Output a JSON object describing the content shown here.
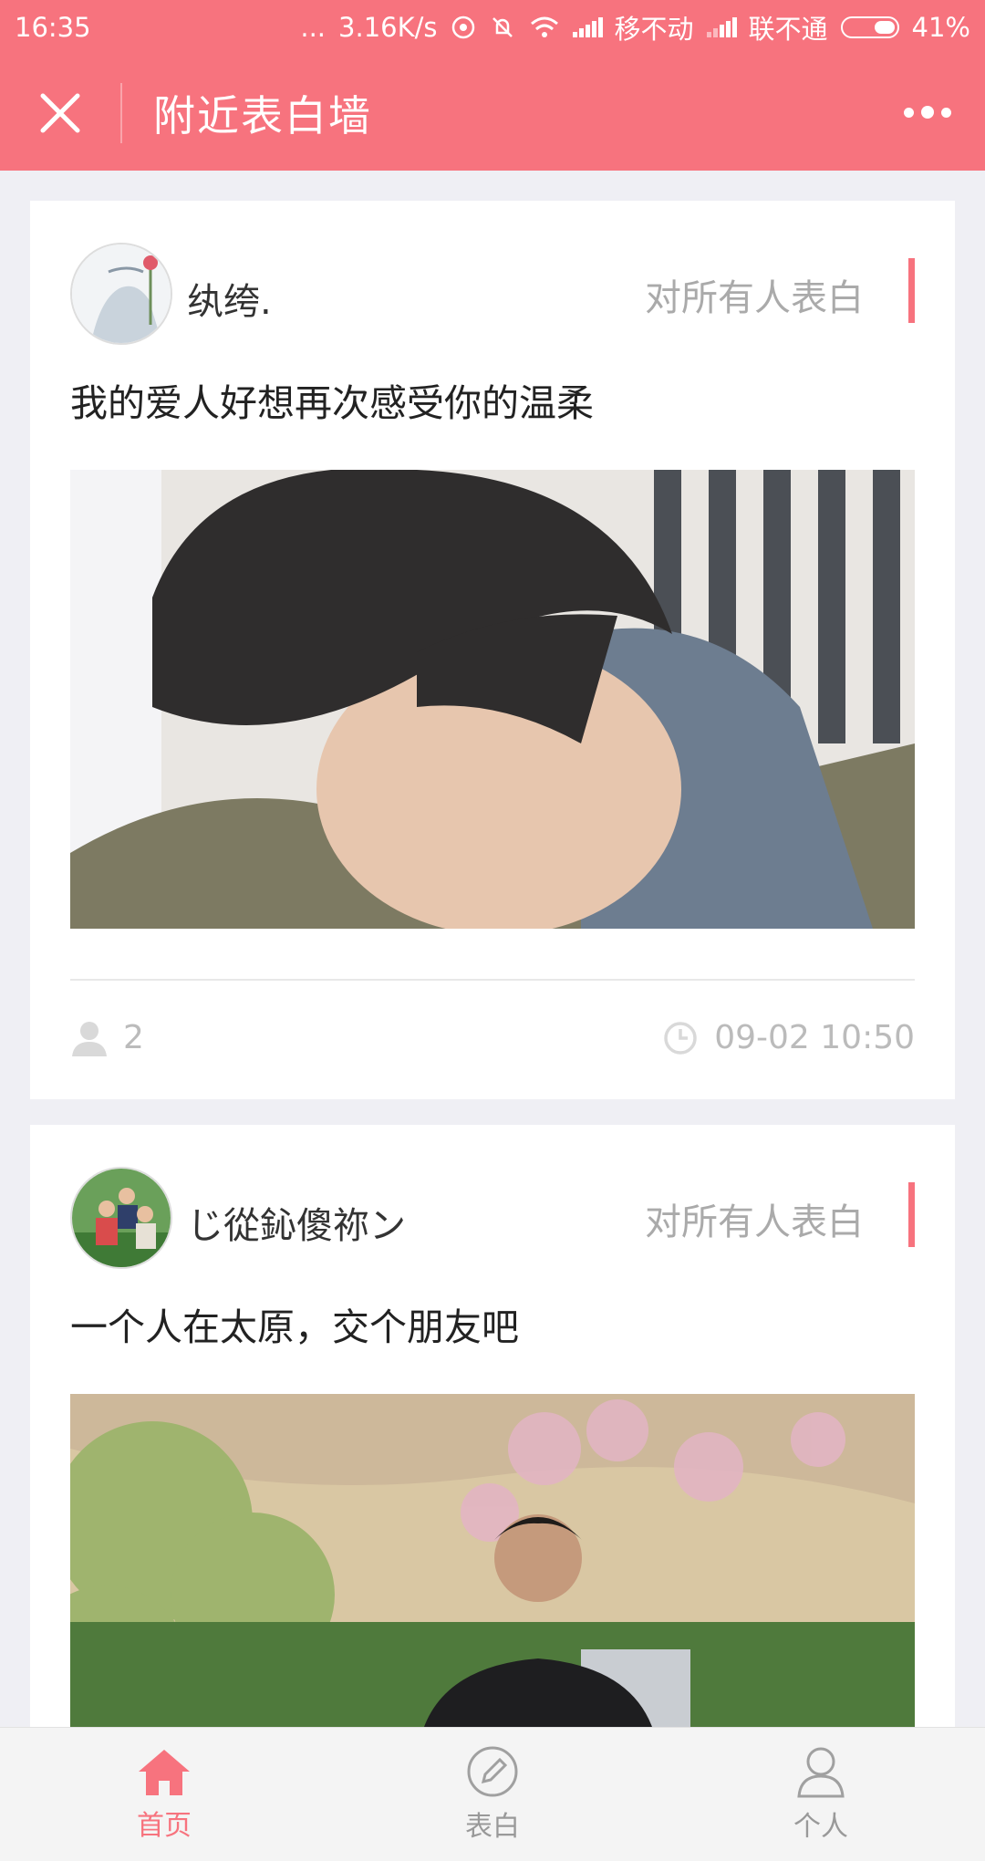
{
  "status_bar": {
    "time": "16:35",
    "dots": "...",
    "speed": "3.16K/s",
    "carrier1": "移不动",
    "carrier2": "联不通",
    "battery": "41%"
  },
  "header": {
    "title": "附近表白墙",
    "close_icon": "close-icon",
    "more_icon": "more-icon"
  },
  "posts": [
    {
      "username": "纨绔.",
      "target": "对所有人表白",
      "text": "我的爱人好想再次感受你的温柔",
      "likes": "2",
      "time": "09-02 10:50"
    },
    {
      "username": "じ從鈊傻祢ン",
      "target": "对所有人表白",
      "text": "一个人在太原，交个朋友吧"
    }
  ],
  "tabs": [
    {
      "label": "首页",
      "icon": "home-icon",
      "active": true
    },
    {
      "label": "表白",
      "icon": "pencil-icon",
      "active": false
    },
    {
      "label": "个人",
      "icon": "person-icon",
      "active": false
    }
  ],
  "colors": {
    "accent": "#f7737e",
    "background": "#efeff4"
  }
}
